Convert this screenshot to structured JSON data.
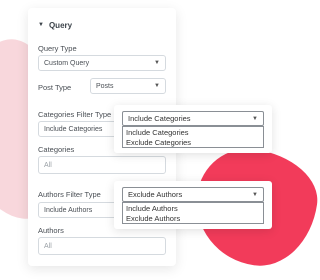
{
  "section": {
    "title": "Query"
  },
  "query_type": {
    "label": "Query Type",
    "value": "Custom Query"
  },
  "post_type": {
    "label": "Post Type",
    "value": "Posts"
  },
  "categories_filter": {
    "label": "Categories Filter Type",
    "value": "Include Categories"
  },
  "categories": {
    "label": "Categories",
    "placeholder": "All"
  },
  "authors_filter": {
    "label": "Authors Filter Type",
    "value": "Include Authors"
  },
  "authors": {
    "label": "Authors",
    "placeholder": "All"
  },
  "categories_popup": {
    "selected": "Include Categories",
    "options": [
      "Include Categories",
      "Exclude Categories"
    ]
  },
  "authors_popup": {
    "selected": "Exclude Authors",
    "options": [
      "Include Authors",
      "Exclude Authors"
    ]
  },
  "colors": {
    "accent": "#f23b5a",
    "accent_light": "#f8d7dc"
  }
}
